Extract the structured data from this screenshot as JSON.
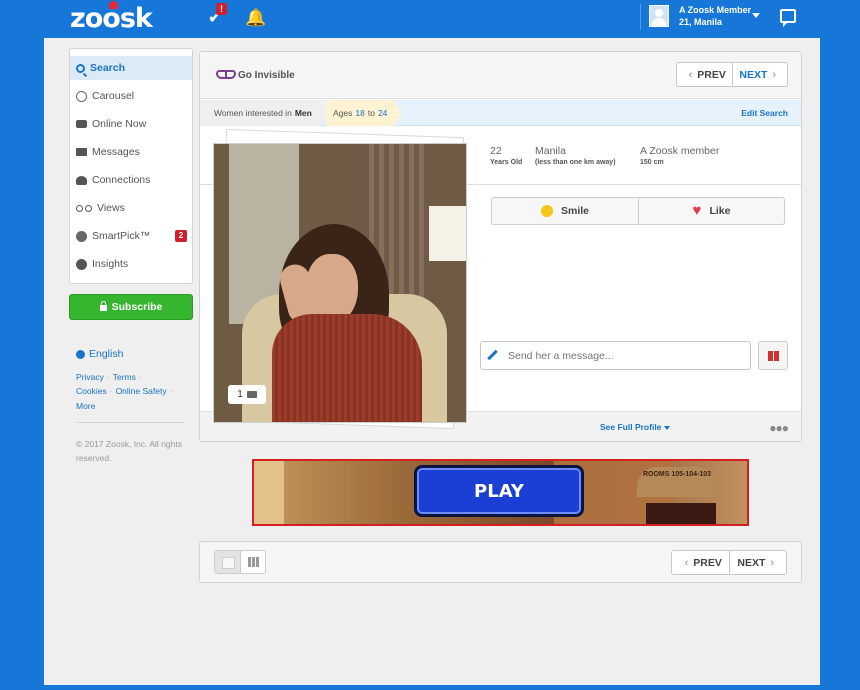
{
  "header": {
    "logo_text": "zoosk",
    "notification_badge": "!",
    "member_name": "A Zoosk Member",
    "member_location": "21, Manila",
    "icons": [
      "check-heart-icon",
      "bell-icon",
      "avatar-icon",
      "chevron-down-icon",
      "chat-bubble-icon"
    ]
  },
  "sidebar": {
    "items": [
      {
        "label": "Search",
        "icon": "search-icon",
        "active": true
      },
      {
        "label": "Carousel",
        "icon": "carousel-icon"
      },
      {
        "label": "Online Now",
        "icon": "chat-dots-icon"
      },
      {
        "label": "Messages",
        "icon": "envelope-icon"
      },
      {
        "label": "Connections",
        "icon": "people-icon"
      },
      {
        "label": "Views",
        "icon": "glasses-icon"
      },
      {
        "label": "SmartPick™",
        "icon": "smartpick-icon",
        "badge": "2"
      },
      {
        "label": "Insights",
        "icon": "insights-icon"
      }
    ],
    "subscribe_label": "Subscribe",
    "language": "English",
    "footer_links": {
      "privacy": "Privacy",
      "terms": "Terms",
      "cookies": "Cookies",
      "online_safety": "Online Safety",
      "more": "More"
    },
    "copyright": "© 2017 Zoosk, Inc. All rights reserved."
  },
  "card": {
    "go_invisible": "Go Invisible",
    "prev_label": "PREV",
    "next_label": "NEXT",
    "filter": {
      "prefix": "Women interested in",
      "gender": "Men",
      "ages_label": "Ages",
      "age_min": "18",
      "age_to": "to",
      "age_max": "24",
      "edit_search": "Edit Search"
    },
    "profile": {
      "age": "22",
      "age_caption": "Years Old",
      "location": "Manila",
      "location_caption": "(less than one km away)",
      "name": "A Zoosk member",
      "height": "150 cm",
      "photo_count": "1"
    },
    "smile_label": "Smile",
    "like_label": "Like",
    "message_placeholder": "Send her a message...",
    "see_full_profile": "See Full Profile"
  },
  "ad": {
    "play_label": "PLAY",
    "sign_text": "ROOMS\n105-104-103"
  },
  "bottom": {
    "prev_label": "PREV",
    "next_label": "NEXT"
  },
  "colors": {
    "brand_blue": "#1777d9",
    "link_blue": "#1a73c8",
    "subscribe_green": "#36b52f",
    "badge_red": "#d21f2e"
  }
}
